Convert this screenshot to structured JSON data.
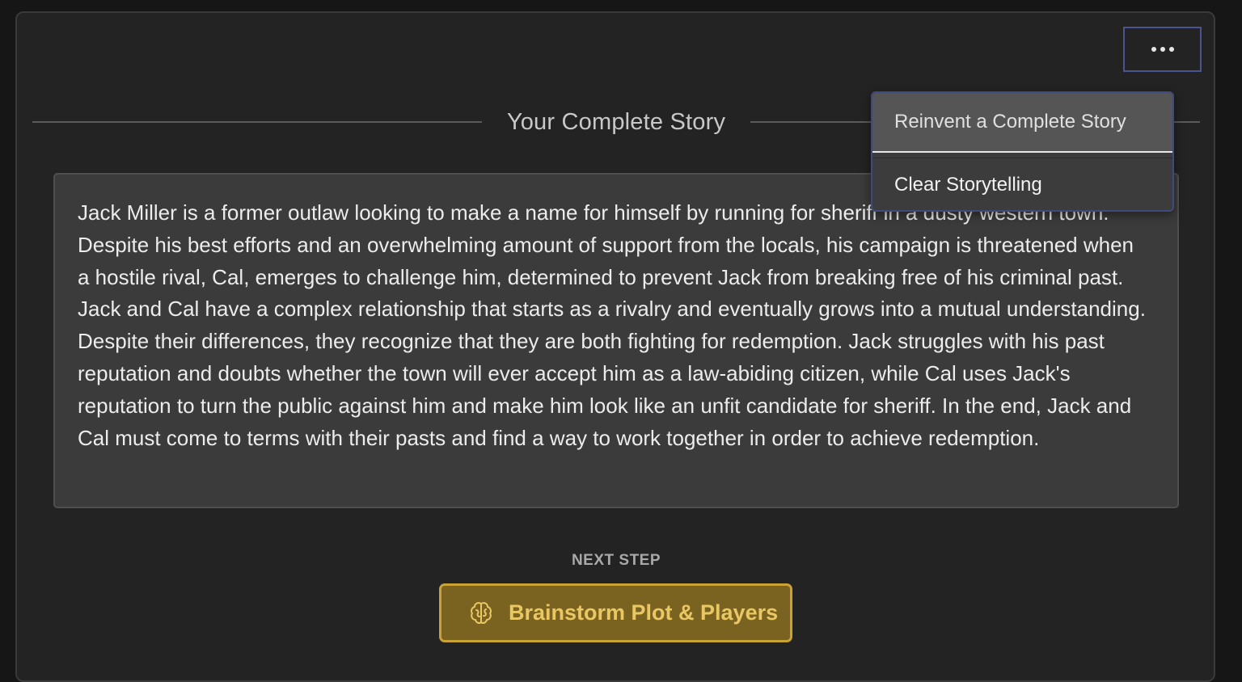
{
  "header": {
    "title": "Your Complete Story",
    "more_icon": "ellipsis-icon"
  },
  "menu": {
    "items": [
      {
        "label": "Reinvent a Complete Story"
      },
      {
        "label": "Clear Storytelling"
      }
    ]
  },
  "story": {
    "text": "Jack Miller is a former outlaw looking to make a name for himself by running for sheriff in a dusty western town. Despite his best efforts and an overwhelming amount of support from the locals, his campaign is threatened when a hostile rival, Cal, emerges to challenge him, determined to prevent Jack from breaking free of his criminal past. Jack and Cal have a complex relationship that starts as a rivalry and eventually grows into a mutual understanding. Despite their differences, they recognize that they are both fighting for redemption. Jack struggles with his past reputation and doubts whether the town will ever accept him as a law-abiding citizen, while Cal uses Jack's reputation to turn the public against him and make him look like an unfit candidate for sheriff. In the end, Jack and Cal must come to terms with their pasts and find a way to work together in order to achieve redemption."
  },
  "next_step": {
    "label": "NEXT STEP",
    "button_label": "Brainstorm Plot & Players",
    "button_icon": "brain-icon"
  },
  "colors": {
    "accent_gold": "#c9a236",
    "menu_border": "#3e4a7a"
  }
}
